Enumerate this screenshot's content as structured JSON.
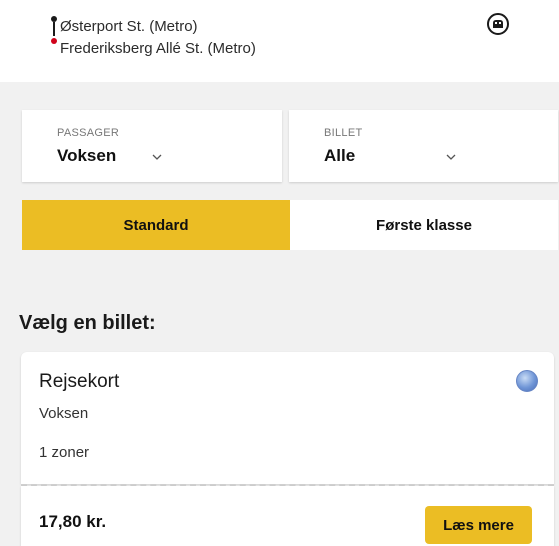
{
  "route": {
    "from": "Østerport St. (Metro)",
    "to": "Frederiksberg Allé St. (Metro)"
  },
  "selectors": {
    "passenger": {
      "label": "PASSAGER",
      "value": "Voksen"
    },
    "ticket": {
      "label": "BILLET",
      "value": "Alle"
    }
  },
  "class_toggle": {
    "standard": "Standard",
    "first": "Første klasse",
    "selected": "standard"
  },
  "section_title": "Vælg en billet:",
  "ticket_card": {
    "name": "Rejsekort",
    "passenger": "Voksen",
    "zones": "1 zoner",
    "price": "17,80 kr.",
    "more_label": "Læs mere"
  },
  "colors": {
    "accent": "#ebbd24",
    "route_end_dot": "#d0021b",
    "background": "#f1f1f1"
  },
  "icons": {
    "metro": "metro-icon",
    "chevron": "chevron-down-icon",
    "radio": "radio-selected-icon"
  }
}
